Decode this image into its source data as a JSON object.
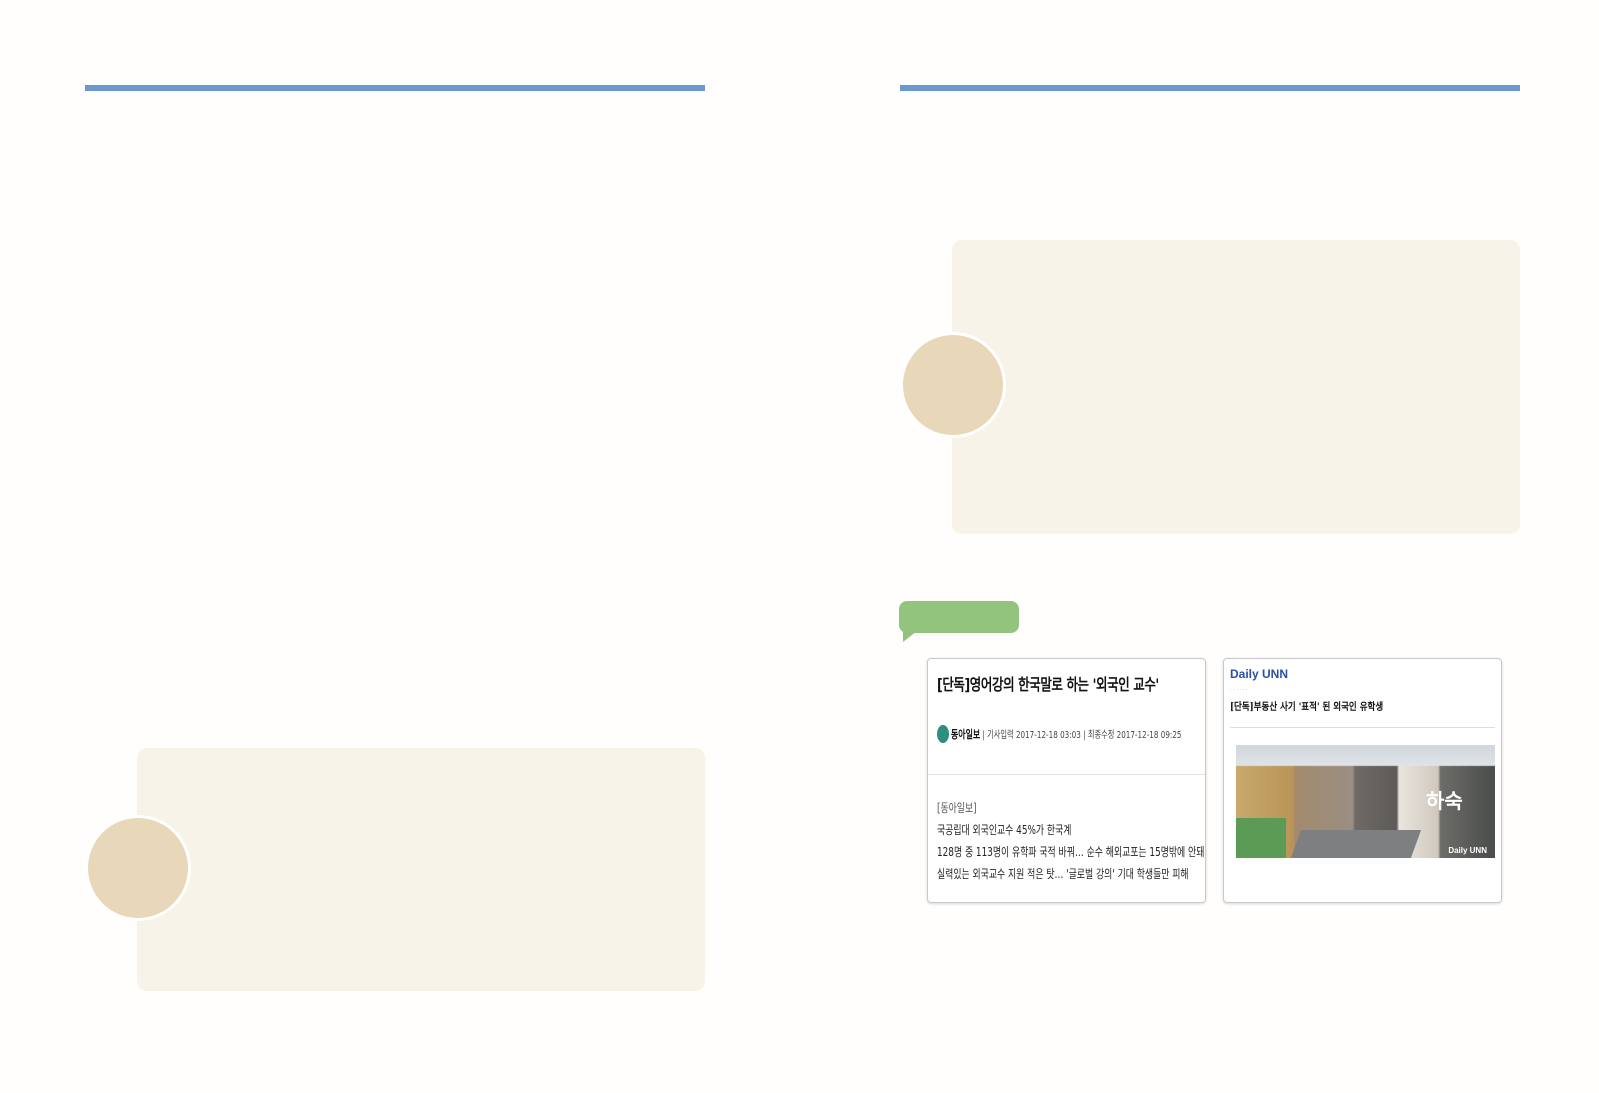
{
  "colors": {
    "rule_blue": "#6a98cf",
    "box_cream": "#f8f3e8",
    "circle_tan": "#e8d7b8",
    "tag_green": "#93c47d"
  },
  "clip_donga": {
    "headline": "[단독]영어강의 한국말로 하는 '외국인 교수'",
    "publisher": "동아일보",
    "byline_rest": "| 기사입력 2017-12-18 03:03 | 최종수정 2017-12-18 09:25",
    "source": "[동아일보]",
    "lines": [
      "국공립대 외국인교수 45%가 한국계",
      "128명 중 113명이 유학파 국적 바꿔… 순수 해외교포는 15명밖에 안돼",
      "실력있는 외국교수 지원 적은 탓… '글로벌 강의' 기대 학생들만 피해"
    ]
  },
  "clip_unn": {
    "brand": "Daily UNN",
    "title": "[단독]부동산 사기 '표적' 된 외국인 유학생",
    "photo_sign": "하숙",
    "photo_watermark": "Daily UNN"
  }
}
